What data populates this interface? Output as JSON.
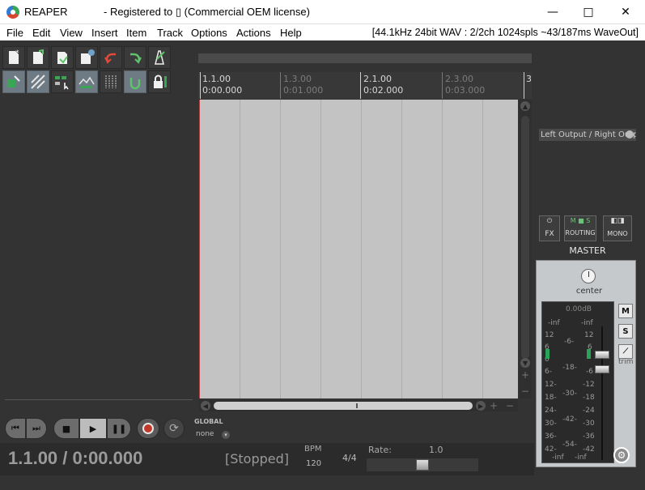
{
  "window": {
    "app_name": "REAPER",
    "registration": "- Registered to ▯ (Commercial OEM license)",
    "minimize_glyph": "—",
    "maximize_glyph": "□",
    "close_glyph": "✕"
  },
  "menu": {
    "items": [
      "File",
      "Edit",
      "View",
      "Insert",
      "Item",
      "Track",
      "Options",
      "Actions",
      "Help"
    ],
    "audio_status": "[44.1kHz 24bit WAV : 2/2ch 1024spls ~43/187ms WaveOut]"
  },
  "toolbar": {
    "row1": [
      "new-project-icon",
      "open-project-icon",
      "save-project-icon",
      "project-settings-icon",
      "undo-icon",
      "redo-icon",
      "metronome-icon"
    ],
    "row2": [
      "grid-snap-icon",
      "ripple-edit-icon",
      "item-grouping-icon",
      "envelope-follow-icon",
      "grid-lines-icon",
      "loop-points-icon",
      "lock-icon"
    ],
    "active_row2": [
      0,
      1,
      3,
      5
    ]
  },
  "ruler": {
    "marks": [
      {
        "bar": "1.1.00",
        "time": "0:00.000",
        "major": true
      },
      {
        "bar": "1.3.00",
        "time": "0:01.000",
        "major": false
      },
      {
        "bar": "2.1.00",
        "time": "0:02.000",
        "major": true
      },
      {
        "bar": "2.3.00",
        "time": "0:03.000",
        "major": false
      },
      {
        "bar": "3",
        "time": "",
        "major": true
      }
    ]
  },
  "mixer": {
    "output_label": "Left Output / Right Output",
    "fx_label": "FX",
    "routing_label": "ROUTING",
    "mono_label": "MONO",
    "master_label": "MASTER",
    "pan_label": "center",
    "volume_db": "0.00dB",
    "mute_label": "M",
    "solo_label": "S",
    "trim_label": "trim",
    "meter_left_scale": [
      "-inf",
      "12",
      "6",
      "0",
      "6-",
      "12-",
      "18-",
      "24-",
      "30-",
      "36-",
      "42-"
    ],
    "meter_center_scale": [
      "-6-",
      "-18-",
      "-30-",
      "-42-",
      "-54-"
    ],
    "meter_right_scale": [
      "-inf",
      "12",
      "6",
      "-6",
      "-12",
      "-18",
      "-24",
      "-30",
      "-36",
      "-42",
      "-inf"
    ],
    "inf_bottom_left": "-inf",
    "inf_bottom_right": "-inf"
  },
  "transport": {
    "global_label": "GLOBAL",
    "automation_mode": "none"
  },
  "status": {
    "position": "1.1.00 / 0:00.000",
    "play_state": "[Stopped]",
    "bpm_label": "BPM",
    "bpm_value": "120",
    "time_signature": "4/4",
    "rate_label": "Rate:",
    "rate_value": "1.0"
  }
}
